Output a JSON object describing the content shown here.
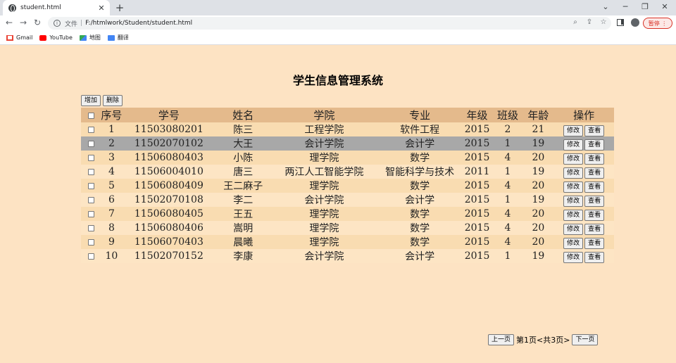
{
  "browser": {
    "tab_title": "student.html",
    "tab_close": "✕",
    "new_tab": "+",
    "back": "←",
    "forward": "→",
    "reload": "↻",
    "url_scheme": "文件",
    "url_separator": "|",
    "url": "F:/htmlwork/Student/student.html",
    "paused_label": "暂停",
    "minimize": "─",
    "restore": "❐",
    "close": "✕",
    "chevron": "⌄"
  },
  "bookmarks": [
    {
      "label": "Gmail",
      "icon": "gmail-icon"
    },
    {
      "label": "YouTube",
      "icon": "youtube-icon"
    },
    {
      "label": "地图",
      "icon": "maps-icon"
    },
    {
      "label": "翻译",
      "icon": "translate-icon"
    }
  ],
  "page": {
    "title": "学生信息管理系统",
    "add_button": "增加",
    "delete_button": "删除"
  },
  "table": {
    "headers": [
      "序号",
      "学号",
      "姓名",
      "学院",
      "专业",
      "年级",
      "班级",
      "年龄",
      "操作"
    ],
    "edit_label": "修改",
    "view_label": "查看",
    "selected_row": 2,
    "rows": [
      [
        "1",
        "11503080201",
        "陈三",
        "工程学院",
        "软件工程",
        "2015",
        "2",
        "21"
      ],
      [
        "2",
        "11502070102",
        "大王",
        "会计学院",
        "会计学",
        "2015",
        "1",
        "19"
      ],
      [
        "3",
        "11506080403",
        "小陈",
        "理学院",
        "数学",
        "2015",
        "4",
        "20"
      ],
      [
        "4",
        "11506004010",
        "唐三",
        "两江人工智能学院",
        "智能科学与技术",
        "2011",
        "1",
        "19"
      ],
      [
        "5",
        "11506080409",
        "王二麻子",
        "理学院",
        "数学",
        "2015",
        "4",
        "20"
      ],
      [
        "6",
        "11502070108",
        "李二",
        "会计学院",
        "会计学",
        "2015",
        "1",
        "19"
      ],
      [
        "7",
        "11506080405",
        "王五",
        "理学院",
        "数学",
        "2015",
        "4",
        "20"
      ],
      [
        "8",
        "11506080406",
        "嵩明",
        "理学院",
        "数学",
        "2015",
        "4",
        "20"
      ],
      [
        "9",
        "11506070403",
        "晨曦",
        "理学院",
        "数学",
        "2015",
        "4",
        "20"
      ],
      [
        "10",
        "11502070152",
        "李康",
        "会计学院",
        "会计学",
        "2015",
        "1",
        "19"
      ]
    ]
  },
  "pager": {
    "prev": "上一页",
    "info": "第1页<共3页>",
    "next": "下一页"
  }
}
